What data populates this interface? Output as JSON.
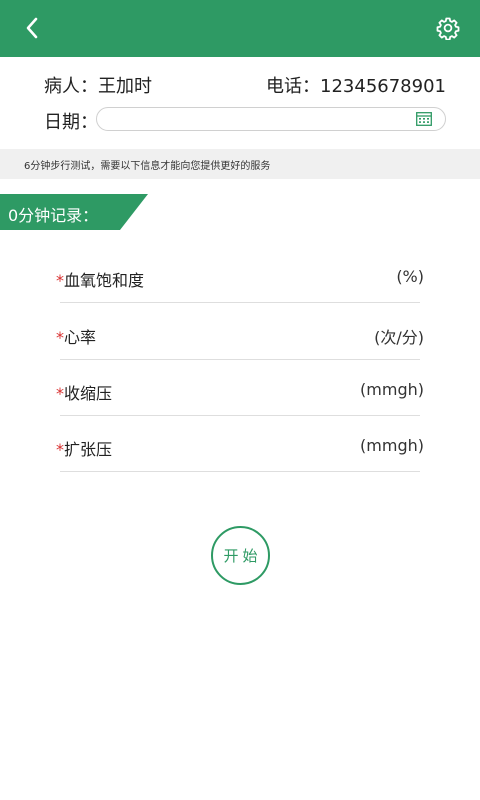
{
  "header": {
    "back_icon": "chevron-left-icon",
    "settings_icon": "gear-icon",
    "color": "#2e9a64"
  },
  "patient": {
    "name_text": "病人：王加时",
    "phone_text": "电话：12345678901"
  },
  "date": {
    "label": "日期：",
    "value": "",
    "icon": "calendar-icon"
  },
  "info": {
    "text": "6分钟步行测试，需要以下信息才能向您提供更好的服务"
  },
  "section": {
    "title": "0分钟记录："
  },
  "fields": [
    {
      "required_mark": "*",
      "label": "血氧饱和度",
      "unit": "(%)"
    },
    {
      "required_mark": "*",
      "label": "心率",
      "unit": "(次/分)"
    },
    {
      "required_mark": "*",
      "label": "收缩压",
      "unit": "(mmgh)"
    },
    {
      "required_mark": "*",
      "label": "扩张压",
      "unit": "(mmgh)"
    }
  ],
  "start_button": {
    "label": "开始"
  },
  "colors": {
    "accent": "#2e9a64",
    "required": "#d93030"
  }
}
